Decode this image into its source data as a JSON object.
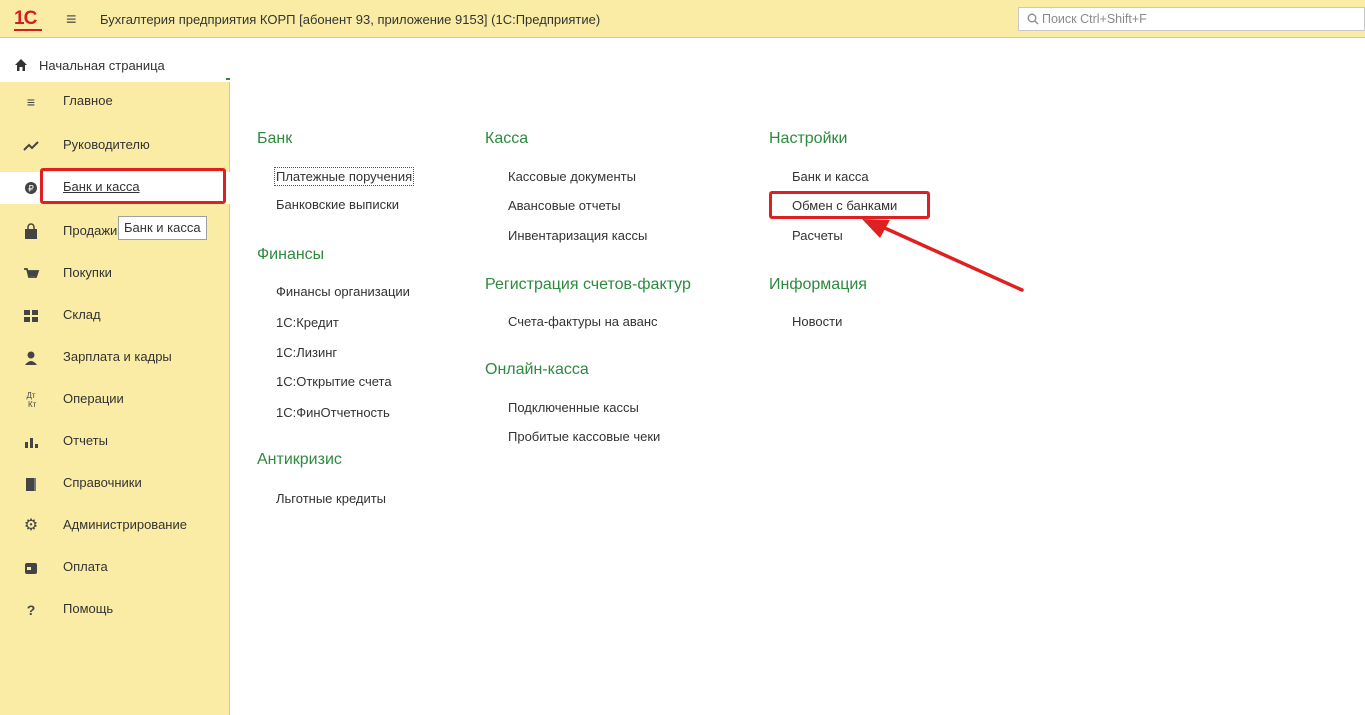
{
  "topbar": {
    "logo": "1С",
    "title": "Бухгалтерия предприятия КОРП [абонент 93, приложение 9153]  (1С:Предприятие)",
    "search_placeholder": "Поиск Ctrl+Shift+F"
  },
  "home_tab": {
    "label": "Начальная страница"
  },
  "sidebar": {
    "items": [
      {
        "label": "Главное",
        "icon": "list-icon"
      },
      {
        "label": "Руководителю",
        "icon": "trend-icon"
      },
      {
        "label": "Банк и касса",
        "icon": "coin-icon",
        "active": true
      },
      {
        "label": "Продажи",
        "icon": "bag-icon"
      },
      {
        "label": "Покупки",
        "icon": "cart-icon"
      },
      {
        "label": "Склад",
        "icon": "warehouse-icon"
      },
      {
        "label": "Зарплата и кадры",
        "icon": "person-icon"
      },
      {
        "label": "Операции",
        "icon": "debit-credit-icon"
      },
      {
        "label": "Отчеты",
        "icon": "bar-chart-icon"
      },
      {
        "label": "Справочники",
        "icon": "book-icon"
      },
      {
        "label": "Администрирование",
        "icon": "gear-icon"
      },
      {
        "label": "Оплата",
        "icon": "wallet-icon"
      },
      {
        "label": "Помощь",
        "icon": "question-icon"
      }
    ],
    "tooltip": "Банк и касса"
  },
  "content": {
    "bank": {
      "title": "Банк",
      "links": [
        "Платежные поручения",
        "Банковские выписки"
      ]
    },
    "finance": {
      "title": "Финансы",
      "links": [
        "Финансы организации",
        "1С:Кредит",
        "1С:Лизинг",
        "1С:Открытие счета",
        "1С:ФинОтчетность"
      ]
    },
    "anticrisis": {
      "title": "Антикризис",
      "links": [
        "Льготные кредиты"
      ]
    },
    "cash": {
      "title": "Касса",
      "links": [
        "Кассовые документы",
        "Авансовые отчеты",
        "Инвентаризация кассы"
      ]
    },
    "invoices": {
      "title": "Регистрация счетов-фактур",
      "links": [
        "Счета-фактуры на аванс"
      ]
    },
    "online_cash": {
      "title": "Онлайн-касса",
      "links": [
        "Подключенные кассы",
        "Пробитые кассовые чеки"
      ]
    },
    "settings": {
      "title": "Настройки",
      "links": [
        "Банк и касса",
        "Обмен с банками",
        "Расчеты"
      ]
    },
    "info": {
      "title": "Информация",
      "links": [
        "Новости"
      ]
    }
  },
  "colors": {
    "panel": "#fbeca5",
    "accent_green": "#2d8a3e",
    "highlight_red": "#e02020"
  }
}
